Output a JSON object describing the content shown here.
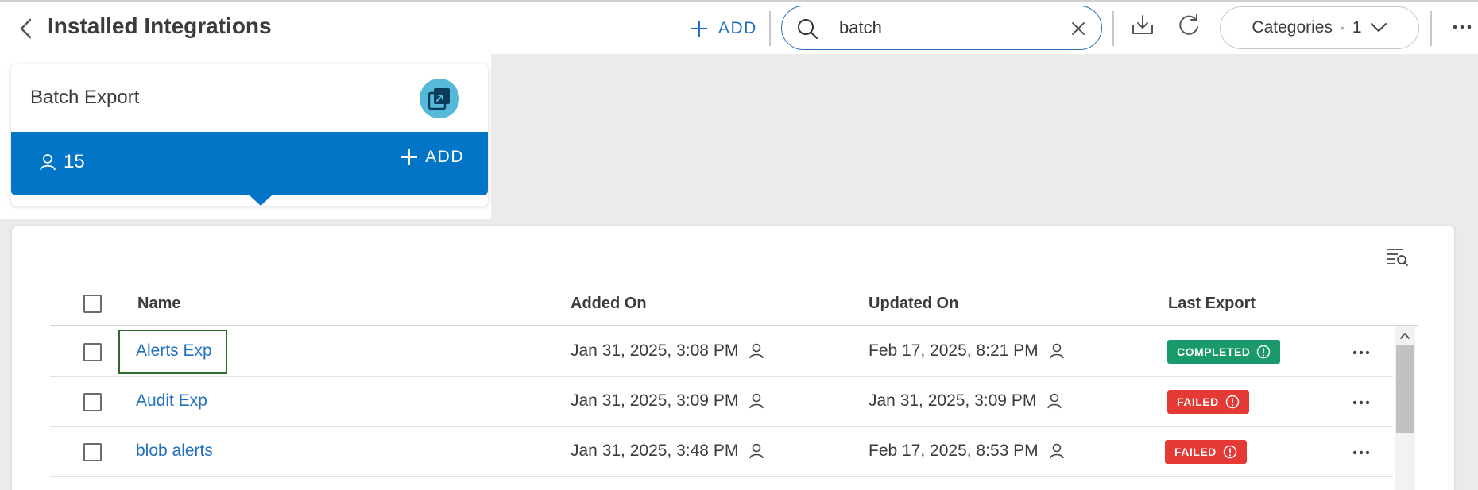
{
  "header": {
    "title": "Installed Integrations",
    "add_label": "ADD",
    "search": {
      "value": "batch",
      "placeholder": ""
    },
    "categories": {
      "label": "Categories",
      "count": "1"
    }
  },
  "popover": {
    "card_title": "Batch Export",
    "user_count": "15",
    "add_label": "ADD",
    "accent_color": "#0275c6"
  },
  "table": {
    "columns": [
      "Name",
      "Added On",
      "Updated On",
      "Last Export"
    ],
    "rows": [
      {
        "name": "Alerts Exp",
        "added_on": "Jan 31, 2025, 3:08 PM",
        "updated_on": "Feb 17, 2025, 8:21 PM",
        "last_export": "COMPLETED",
        "status_color": "#1a9a6a"
      },
      {
        "name": "Audit Exp",
        "added_on": "Jan 31, 2025, 3:09 PM",
        "updated_on": "Jan 31, 2025, 3:09 PM",
        "last_export": "FAILED",
        "status_color": "#e53935"
      },
      {
        "name": "blob alerts",
        "added_on": "Jan 31, 2025, 3:48 PM",
        "updated_on": "Feb 17, 2025, 8:53 PM",
        "last_export": "FAILED",
        "status_color": "#e53935"
      }
    ]
  }
}
